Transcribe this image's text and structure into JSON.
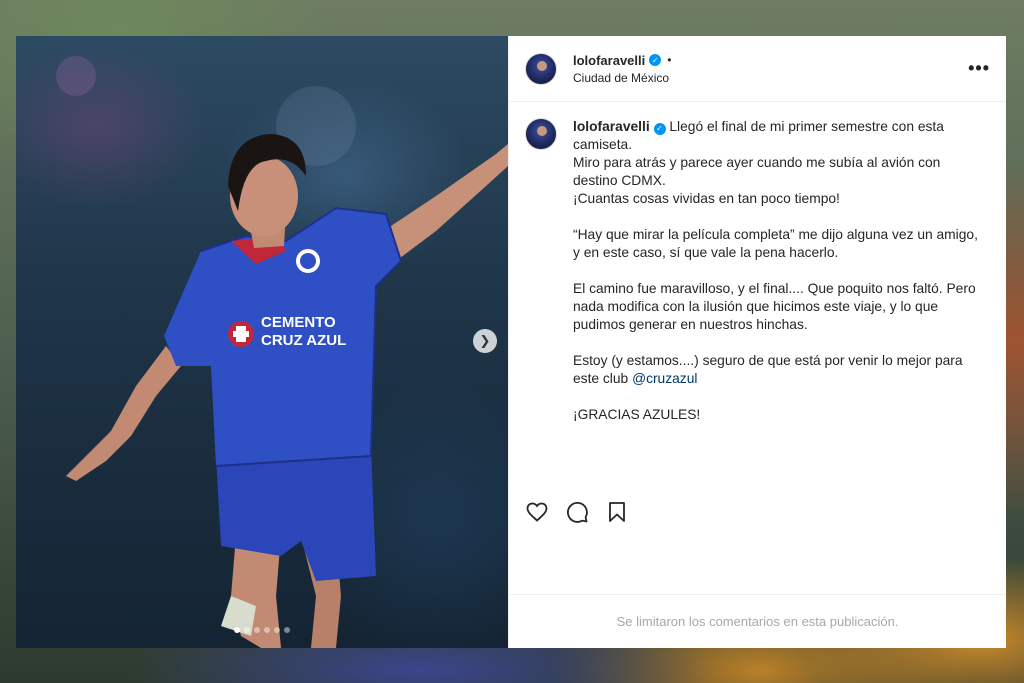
{
  "post": {
    "username": "lolofaravelli",
    "verified": true,
    "separator": "•",
    "location": "Ciudad de México",
    "more_label": "•••"
  },
  "caption": {
    "username": "lolofaravelli",
    "line1": "Llegó el final de mi primer semestre con esta camiseta.",
    "line2": "Miro para atrás y parece ayer cuando me subía al avión con destino CDMX.",
    "line3": "¡Cuantas cosas vividas en tan poco tiempo!",
    "para2": "“Hay que mirar la película completa” me dijo alguna vez un amigo, y en este caso, sí que vale la pena hacerlo.",
    "para3": "El camino fue maravilloso, y el final.... Que poquito nos faltó. Pero nada modifica con la ilusión que hicimos este viaje, y lo que pudimos generar en nuestros hinchas.",
    "para4_text": "Estoy (y estamos....) seguro de que está por venir lo mejor para este club ",
    "para4_mention": "@cruzazul",
    "para5": "¡GRACIAS AZULES!"
  },
  "photo": {
    "jersey_sponsor_line1": "CEMENTO",
    "jersey_sponsor_line2": "CRUZ AZUL",
    "carousel_count": 6,
    "carousel_active_index": 0
  },
  "actions": {
    "like": "heart-icon",
    "comment": "comment-icon",
    "save": "bookmark-icon"
  },
  "footer": {
    "comments_limited": "Se limitaron los comentarios en esta publicación."
  },
  "colors": {
    "verified_blue": "#0095f6",
    "mention": "#00376b",
    "jersey_blue": "#2f4fc4"
  }
}
